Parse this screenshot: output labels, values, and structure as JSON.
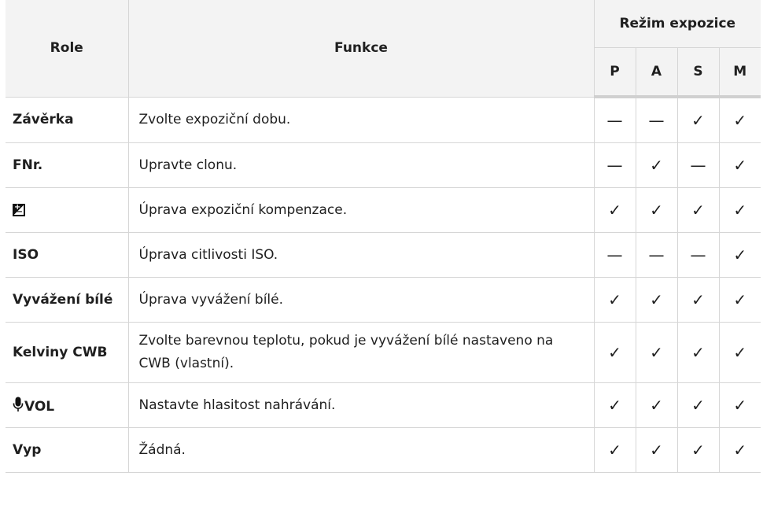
{
  "headers": {
    "role": "Role",
    "function": "Funkce",
    "exposure_mode": "Režim expozice",
    "modes": [
      "P",
      "A",
      "S",
      "M"
    ]
  },
  "symbols": {
    "check": "✓",
    "dash": "—"
  },
  "icons": {
    "exposure_compensation": "exposure-compensation-icon",
    "microphone": "microphone-icon"
  },
  "rows": [
    {
      "role": "Závěrka",
      "function": "Zvolte expoziční dobu.",
      "P": "—",
      "A": "—",
      "S": "✓",
      "M": "✓"
    },
    {
      "role": "FNr.",
      "function": "Upravte clonu.",
      "P": "—",
      "A": "✓",
      "S": "—",
      "M": "✓"
    },
    {
      "role": "",
      "role_icon": "exposure-compensation-icon",
      "function": "Úprava expoziční kompenzace.",
      "P": "✓",
      "A": "✓",
      "S": "✓",
      "M": "✓"
    },
    {
      "role": "ISO",
      "function": "Úprava citlivosti ISO.",
      "P": "—",
      "A": "—",
      "S": "—",
      "M": "✓"
    },
    {
      "role": "Vyvážení bílé",
      "function": "Úprava vyvážení bílé.",
      "P": "✓",
      "A": "✓",
      "S": "✓",
      "M": "✓"
    },
    {
      "role": "Kelviny CWB",
      "function": "Zvolte barevnou teplotu, pokud je vyvážení bílé nastaveno na CWB (vlastní).",
      "P": "✓",
      "A": "✓",
      "S": "✓",
      "M": "✓"
    },
    {
      "role": "VOL",
      "role_icon": "microphone-icon",
      "function": "Nastavte hlasitost nahrávání.",
      "P": "✓",
      "A": "✓",
      "S": "✓",
      "M": "✓"
    },
    {
      "role": "Vyp",
      "function": "Žádná.",
      "P": "✓",
      "A": "✓",
      "S": "✓",
      "M": "✓"
    }
  ]
}
